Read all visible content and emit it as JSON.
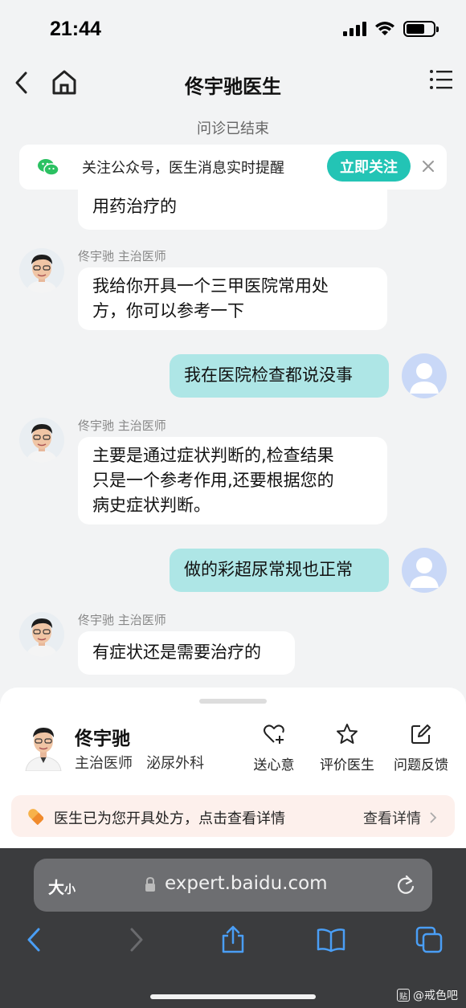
{
  "status_bar": {
    "time": "21:44"
  },
  "nav": {
    "title": "佟宇驰医生"
  },
  "session_status": "问诊已结束",
  "follow_banner": {
    "text": "关注公众号，医生消息实时提醒",
    "button": "立即关注"
  },
  "messages": [
    {
      "from": "doctor",
      "text": "用药治疗的",
      "partial": true
    },
    {
      "from": "doctor",
      "label": "佟宇驰 主治医师",
      "lines": [
        "我给你开具一个三甲医院常用处",
        "方，你可以参考一下"
      ]
    },
    {
      "from": "user",
      "text": "我在医院检查都说没事"
    },
    {
      "from": "doctor",
      "label": "佟宇驰 主治医师",
      "lines": [
        "主要是通过症状判断的,检查结果",
        "只是一个参考作用,还要根据您的",
        "病史症状判断。"
      ]
    },
    {
      "from": "user",
      "text": "做的彩超尿常规也正常"
    },
    {
      "from": "doctor",
      "label": "佟宇驰 主治医师",
      "lines": [
        "有症状还是需要治疗的"
      ]
    }
  ],
  "doctor_card": {
    "name": "佟宇驰",
    "title": "主治医师",
    "department": "泌尿外科",
    "actions": [
      "送心意",
      "评价医生",
      "问题反馈"
    ]
  },
  "prescription_bar": {
    "text": "医生已为您开具处方，点击查看详情",
    "link": "查看详情"
  },
  "browser": {
    "text_size_big": "大",
    "text_size_small": "小",
    "url": "expert.baidu.com"
  },
  "watermark": {
    "badge": "贴",
    "text": "@戒色吧"
  },
  "colors": {
    "accent": "#23c4b5",
    "user_bubble": "#aee6e6",
    "background": "#f2f3f4",
    "rx_bar": "#fdf0ec"
  }
}
